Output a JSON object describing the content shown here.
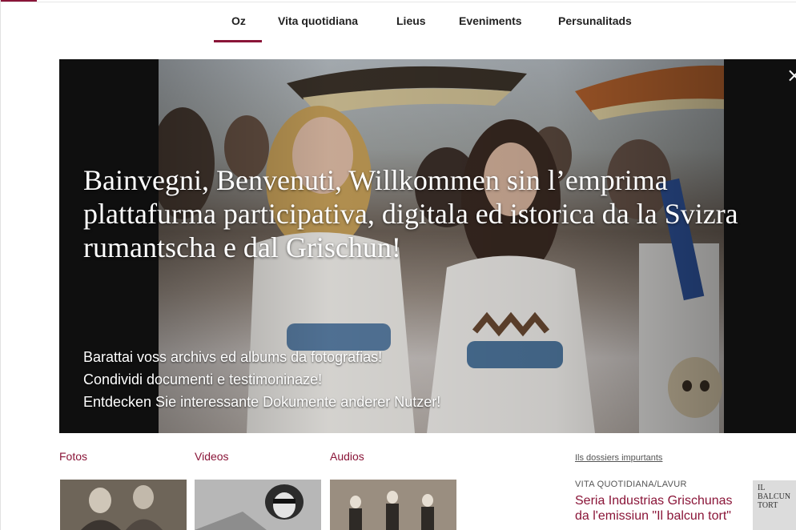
{
  "nav": {
    "items": [
      {
        "label": "Oz",
        "active": true
      },
      {
        "label": "Vita quotidiana"
      },
      {
        "label": "Lieus"
      },
      {
        "label": "Eveniments"
      },
      {
        "label": "Persunalitads"
      }
    ]
  },
  "hero": {
    "title": "Bainvegni, Benvenuti, Willkommen sin l’emprima plattafurma participativa, digitala ed istorica da la Svizra rumantscha e dal Grischun!",
    "lines": [
      "Barattai voss archivs ed albums da fotografias!",
      "Condividi documenti e testimoninaze!",
      "Entdecken Sie interessante Dokumente anderer Nutzer!"
    ],
    "close_label": "×",
    "photo_icon": "historical-photo"
  },
  "media": {
    "fotos_label": "Fotos",
    "videos_label": "Videos",
    "audios_label": "Audios"
  },
  "dossiers": {
    "link_label": "Ils dossiers impurtants",
    "kicker": "VITA QUOTIDIANA/LAVUR",
    "title": "Seria Industrias Grischunas da l'emissiun \"Il balcun tort\"",
    "thumb_text": "IL BALCUN TORT"
  },
  "colors": {
    "accent": "#8a1538",
    "hero_bg": "#0f0f0f"
  }
}
